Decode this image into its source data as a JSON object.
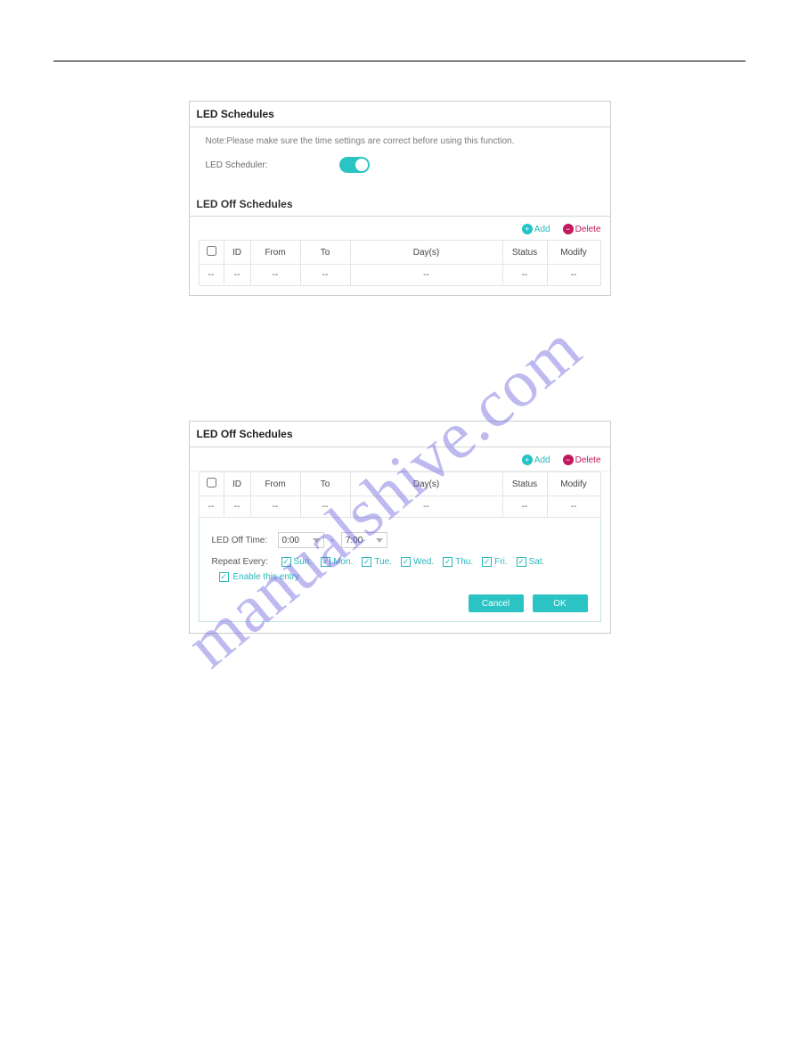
{
  "watermark": "manualshive.com",
  "panel1": {
    "title": "LED Schedules",
    "note": "Note:Please make sure the time settings are correct before using this function.",
    "scheduler_label": "LED Scheduler:",
    "sub_title": "LED Off Schedules",
    "actions": {
      "add": "Add",
      "delete": "Delete"
    },
    "headers": {
      "id": "ID",
      "from": "From",
      "to": "To",
      "days": "Day(s)",
      "status": "Status",
      "modify": "Modify"
    },
    "empty": "--"
  },
  "panel2": {
    "title": "LED Off Schedules",
    "actions": {
      "add": "Add",
      "delete": "Delete"
    },
    "headers": {
      "id": "ID",
      "from": "From",
      "to": "To",
      "days": "Day(s)",
      "status": "Status",
      "modify": "Modify"
    },
    "empty": "--",
    "editor": {
      "time_label": "LED Off Time:",
      "from_val": "0:00",
      "dash": "-",
      "to_val": "7:00",
      "repeat_label": "Repeat Every:",
      "days": {
        "sun": "Sun.",
        "mon": "Mon.",
        "tue": "Tue.",
        "wed": "Wed.",
        "thu": "Thu.",
        "fri": "Fri.",
        "sat": "Sat."
      },
      "enable_label": "Enable this entry",
      "cancel": "Cancel",
      "ok": "OK"
    }
  }
}
